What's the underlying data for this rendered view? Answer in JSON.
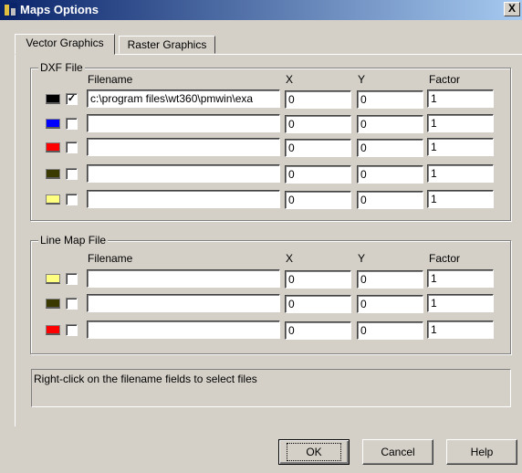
{
  "window": {
    "title": "Maps Options",
    "close_glyph": "X"
  },
  "tabs": [
    {
      "label": "Vector Graphics",
      "active": true
    },
    {
      "label": "Raster Graphics",
      "active": false
    }
  ],
  "dxf": {
    "group_label": "DXF File",
    "headers": {
      "filename": "Filename",
      "x": "X",
      "y": "Y",
      "factor": "Factor"
    },
    "rows": [
      {
        "color": "#000000",
        "checked": true,
        "filename": "c:\\program files\\wt360\\pmwin\\exa",
        "x": "0",
        "y": "0",
        "factor": "1"
      },
      {
        "color": "#0000ff",
        "checked": false,
        "filename": "",
        "x": "0",
        "y": "0",
        "factor": "1"
      },
      {
        "color": "#ff0000",
        "checked": false,
        "filename": "",
        "x": "0",
        "y": "0",
        "factor": "1"
      },
      {
        "color": "#3a3a00",
        "checked": false,
        "filename": "",
        "x": "0",
        "y": "0",
        "factor": "1"
      },
      {
        "color": "#ffff80",
        "checked": false,
        "filename": "",
        "x": "0",
        "y": "0",
        "factor": "1"
      }
    ]
  },
  "linemap": {
    "group_label": "Line Map File",
    "headers": {
      "filename": "Filename",
      "x": "X",
      "y": "Y",
      "factor": "Factor"
    },
    "rows": [
      {
        "color": "#ffff80",
        "checked": false,
        "filename": "",
        "x": "0",
        "y": "0",
        "factor": "1"
      },
      {
        "color": "#3a3a00",
        "checked": false,
        "filename": "",
        "x": "0",
        "y": "0",
        "factor": "1"
      },
      {
        "color": "#ff0000",
        "checked": false,
        "filename": "",
        "x": "0",
        "y": "0",
        "factor": "1"
      }
    ]
  },
  "status_text": "Right-click on the filename fields to select files",
  "buttons": {
    "ok": "OK",
    "cancel": "Cancel",
    "help": "Help"
  },
  "check_glyph": "✓"
}
